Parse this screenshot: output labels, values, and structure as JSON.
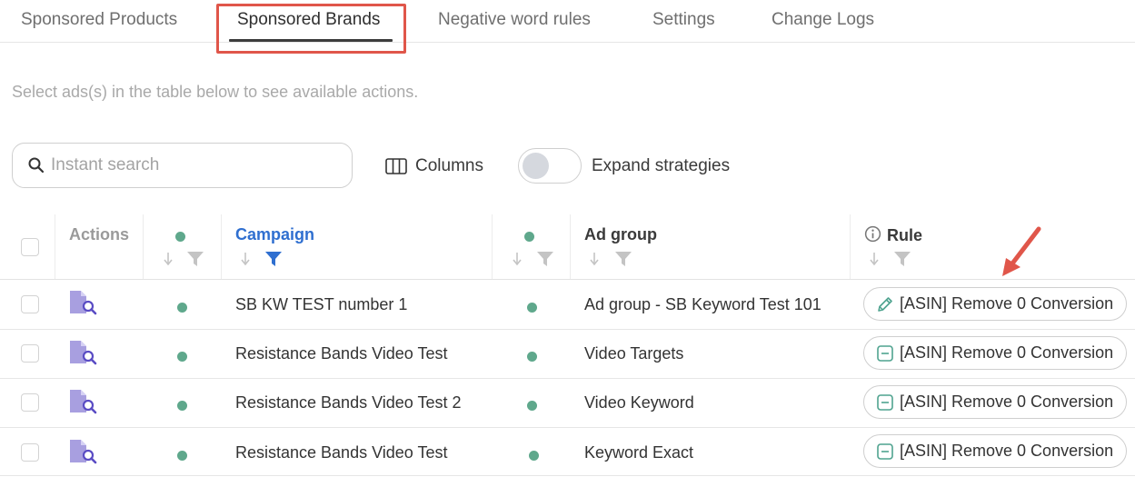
{
  "tabs": [
    {
      "label": "Sponsored Products",
      "active": false
    },
    {
      "label": "Sponsored Brands",
      "active": true
    },
    {
      "label": "Negative word rules",
      "active": false
    },
    {
      "label": "Settings",
      "active": false
    },
    {
      "label": "Change Logs",
      "active": false
    }
  ],
  "hint": "Select ads(s) in the table below to see available actions.",
  "toolbar": {
    "search_placeholder": "Instant search",
    "search_value": "",
    "columns_label": "Columns",
    "expand_label": "Expand strategies",
    "expand_on": false
  },
  "table": {
    "headers": {
      "actions": "Actions",
      "campaign": "Campaign",
      "ad_group": "Ad group",
      "rule": "Rule"
    },
    "rows": [
      {
        "campaign": "SB KW TEST number 1",
        "ad_group": "Ad group - SB Keyword Test 101",
        "rule": "[ASIN] Remove 0 Conversion",
        "rule_icon": "pencil-icon"
      },
      {
        "campaign": "Resistance Bands Video Test",
        "ad_group": "Video Targets",
        "rule": "[ASIN] Remove 0 Conversion",
        "rule_icon": "minus-square-icon"
      },
      {
        "campaign": "Resistance Bands Video Test 2",
        "ad_group": "Video Keyword",
        "rule": "[ASIN] Remove 0 Conversion",
        "rule_icon": "minus-square-icon"
      },
      {
        "campaign": "Resistance Bands Video Test",
        "ad_group": "Keyword Exact",
        "rule": "[ASIN] Remove 0 Conversion",
        "rule_icon": "minus-square-icon"
      }
    ]
  },
  "colors": {
    "status_green": "#5fa88c",
    "accent_blue": "#2f6fd0",
    "rule_icon_teal": "#4fa38f",
    "annotation_red": "#e0564a",
    "action_icon_purple": "#9b8fd6"
  }
}
